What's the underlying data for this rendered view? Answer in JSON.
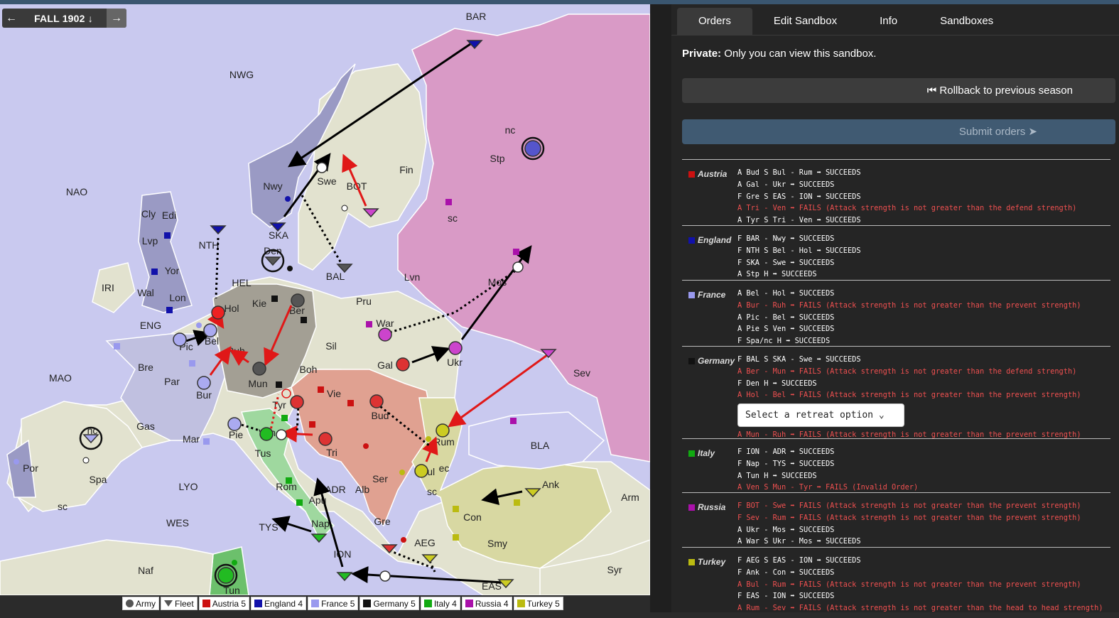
{
  "season": {
    "label": "FALL 1902 ↓",
    "prev_icon": "arrow-left-icon",
    "next_icon": "arrow-right-icon"
  },
  "map": {
    "labels": [
      "BAR",
      "NWG",
      "NAO",
      "Nwy",
      "Swe",
      "BOT",
      "Fin",
      "Stp",
      "nc",
      "sc",
      "Cly",
      "Edi",
      "Lvp",
      "Yor",
      "NTH",
      "SKA",
      "Den",
      "BAL",
      "Lvn",
      "Mos",
      "IRI",
      "Wal",
      "Lon",
      "HEL",
      "Kie",
      "Ber",
      "Pru",
      "War",
      "Hol",
      "ENG",
      "Pic",
      "Bel",
      "Ruh",
      "Sil",
      "Ukr",
      "Gal",
      "Sev",
      "MAO",
      "Bre",
      "Par",
      "Bur",
      "Mun",
      "Boh",
      "Vie",
      "Tyr",
      "Bud",
      "Gas",
      "Mar",
      "Pie",
      "Ven",
      "Tri",
      "Rum",
      "BLA",
      "nc",
      "Por",
      "Spa",
      "sc",
      "LYO",
      "Tus",
      "Rom",
      "Apu",
      "ADR",
      "Alb",
      "Ser",
      "Bul",
      "ec",
      "sc",
      "Ank",
      "Arm",
      "Con",
      "TYS",
      "Nap",
      "Gre",
      "AEG",
      "Smy",
      "WES",
      "ION",
      "Naf",
      "Tun",
      "EAS",
      "Syr"
    ]
  },
  "legend": [
    {
      "label": "Army",
      "icon": "army-icon"
    },
    {
      "label": "Fleet",
      "icon": "fleet-icon"
    },
    {
      "label": "Austria 5",
      "color": "#cc1111"
    },
    {
      "label": "England 4",
      "color": "#1111aa"
    },
    {
      "label": "France 5",
      "color": "#9999ee"
    },
    {
      "label": "Germany 5",
      "color": "#111111"
    },
    {
      "label": "Italy 4",
      "color": "#11aa11"
    },
    {
      "label": "Russia 4",
      "color": "#aa11aa"
    },
    {
      "label": "Turkey 5",
      "color": "#bbbb11"
    }
  ],
  "panel": {
    "tabs": [
      "Orders",
      "Edit Sandbox",
      "Info",
      "Sandboxes"
    ],
    "private_bold": "Private:",
    "private_text": " Only you can view this sandbox.",
    "rollback_label": "Rollback to previous season",
    "submit_label": "Submit orders",
    "retreat_placeholder": "Select a retreat option"
  },
  "powers": [
    {
      "name": "Austria",
      "color": "#cc1111",
      "orders": [
        {
          "text": "A Bud S Bul - Rum ➡ SUCCEEDS",
          "fail": false
        },
        {
          "text": "A Gal - Ukr ➡ SUCCEEDS",
          "fail": false
        },
        {
          "text": "F Gre S EAS - ION ➡ SUCCEEDS",
          "fail": false
        },
        {
          "text": "A Tri - Ven ➡ FAILS (Attack strength is not greater than the defend strength)",
          "fail": true
        },
        {
          "text": "A Tyr S Tri - Ven ➡ SUCCEEDS",
          "fail": false
        }
      ]
    },
    {
      "name": "England",
      "color": "#1111aa",
      "orders": [
        {
          "text": "F BAR - Nwy ➡ SUCCEEDS",
          "fail": false
        },
        {
          "text": "F NTH S Bel - Hol ➡ SUCCEEDS",
          "fail": false
        },
        {
          "text": "F SKA - Swe ➡ SUCCEEDS",
          "fail": false
        },
        {
          "text": "A Stp H ➡ SUCCEEDS",
          "fail": false
        }
      ]
    },
    {
      "name": "France",
      "color": "#9999ee",
      "orders": [
        {
          "text": "A Bel - Hol ➡ SUCCEEDS",
          "fail": false
        },
        {
          "text": "A Bur - Ruh ➡ FAILS (Attack strength is not greater than the prevent strength)",
          "fail": true
        },
        {
          "text": "A Pic - Bel ➡ SUCCEEDS",
          "fail": false
        },
        {
          "text": "A Pie S Ven ➡ SUCCEEDS",
          "fail": false
        },
        {
          "text": "F Spa/nc H ➡ SUCCEEDS",
          "fail": false
        }
      ]
    },
    {
      "name": "Germany",
      "color": "#111111",
      "orders": [
        {
          "text": "F BAL S SKA - Swe ➡ SUCCEEDS",
          "fail": false
        },
        {
          "text": "A Ber - Mun ➡ FAILS (Attack strength is not greater than the defend strength)",
          "fail": true
        },
        {
          "text": "F Den H ➡ SUCCEEDS",
          "fail": false
        },
        {
          "text": "A Hol - Bel ➡ FAILS (Attack strength is not greater than the prevent strength)",
          "fail": true
        },
        {
          "text": "A Mun - Ruh ➡ FAILS (Attack strength is not greater than the prevent strength)",
          "fail": true
        }
      ]
    },
    {
      "name": "Italy",
      "color": "#11aa11",
      "orders": [
        {
          "text": "F ION - ADR ➡ SUCCEEDS",
          "fail": false
        },
        {
          "text": "F Nap - TYS ➡ SUCCEEDS",
          "fail": false
        },
        {
          "text": "A Tun H ➡ SUCCEEDS",
          "fail": false
        },
        {
          "text": "A Ven S Mun - Tyr ➡ FAILS (Invalid Order)",
          "fail": true
        }
      ]
    },
    {
      "name": "Russia",
      "color": "#aa11aa",
      "orders": [
        {
          "text": "F BOT - Swe ➡ FAILS (Attack strength is not greater than the prevent strength)",
          "fail": true
        },
        {
          "text": "F Sev - Rum ➡ FAILS (Attack strength is not greater than the prevent strength)",
          "fail": true
        },
        {
          "text": "A Ukr - Mos ➡ SUCCEEDS",
          "fail": false
        },
        {
          "text": "A War S Ukr - Mos ➡ SUCCEEDS",
          "fail": false
        }
      ]
    },
    {
      "name": "Turkey",
      "color": "#bbbb11",
      "orders": [
        {
          "text": "F AEG S EAS - ION ➡ SUCCEEDS",
          "fail": false
        },
        {
          "text": "F Ank - Con ➡ SUCCEEDS",
          "fail": false
        },
        {
          "text": "A Bul - Rum ➡ FAILS (Attack strength is not greater than the prevent strength)",
          "fail": true
        },
        {
          "text": "F EAS - ION ➡ SUCCEEDS",
          "fail": false
        },
        {
          "text": "A Rum - Sev ➡ FAILS (Attack strength is not greater than the head to head strength)",
          "fail": true
        }
      ]
    }
  ]
}
